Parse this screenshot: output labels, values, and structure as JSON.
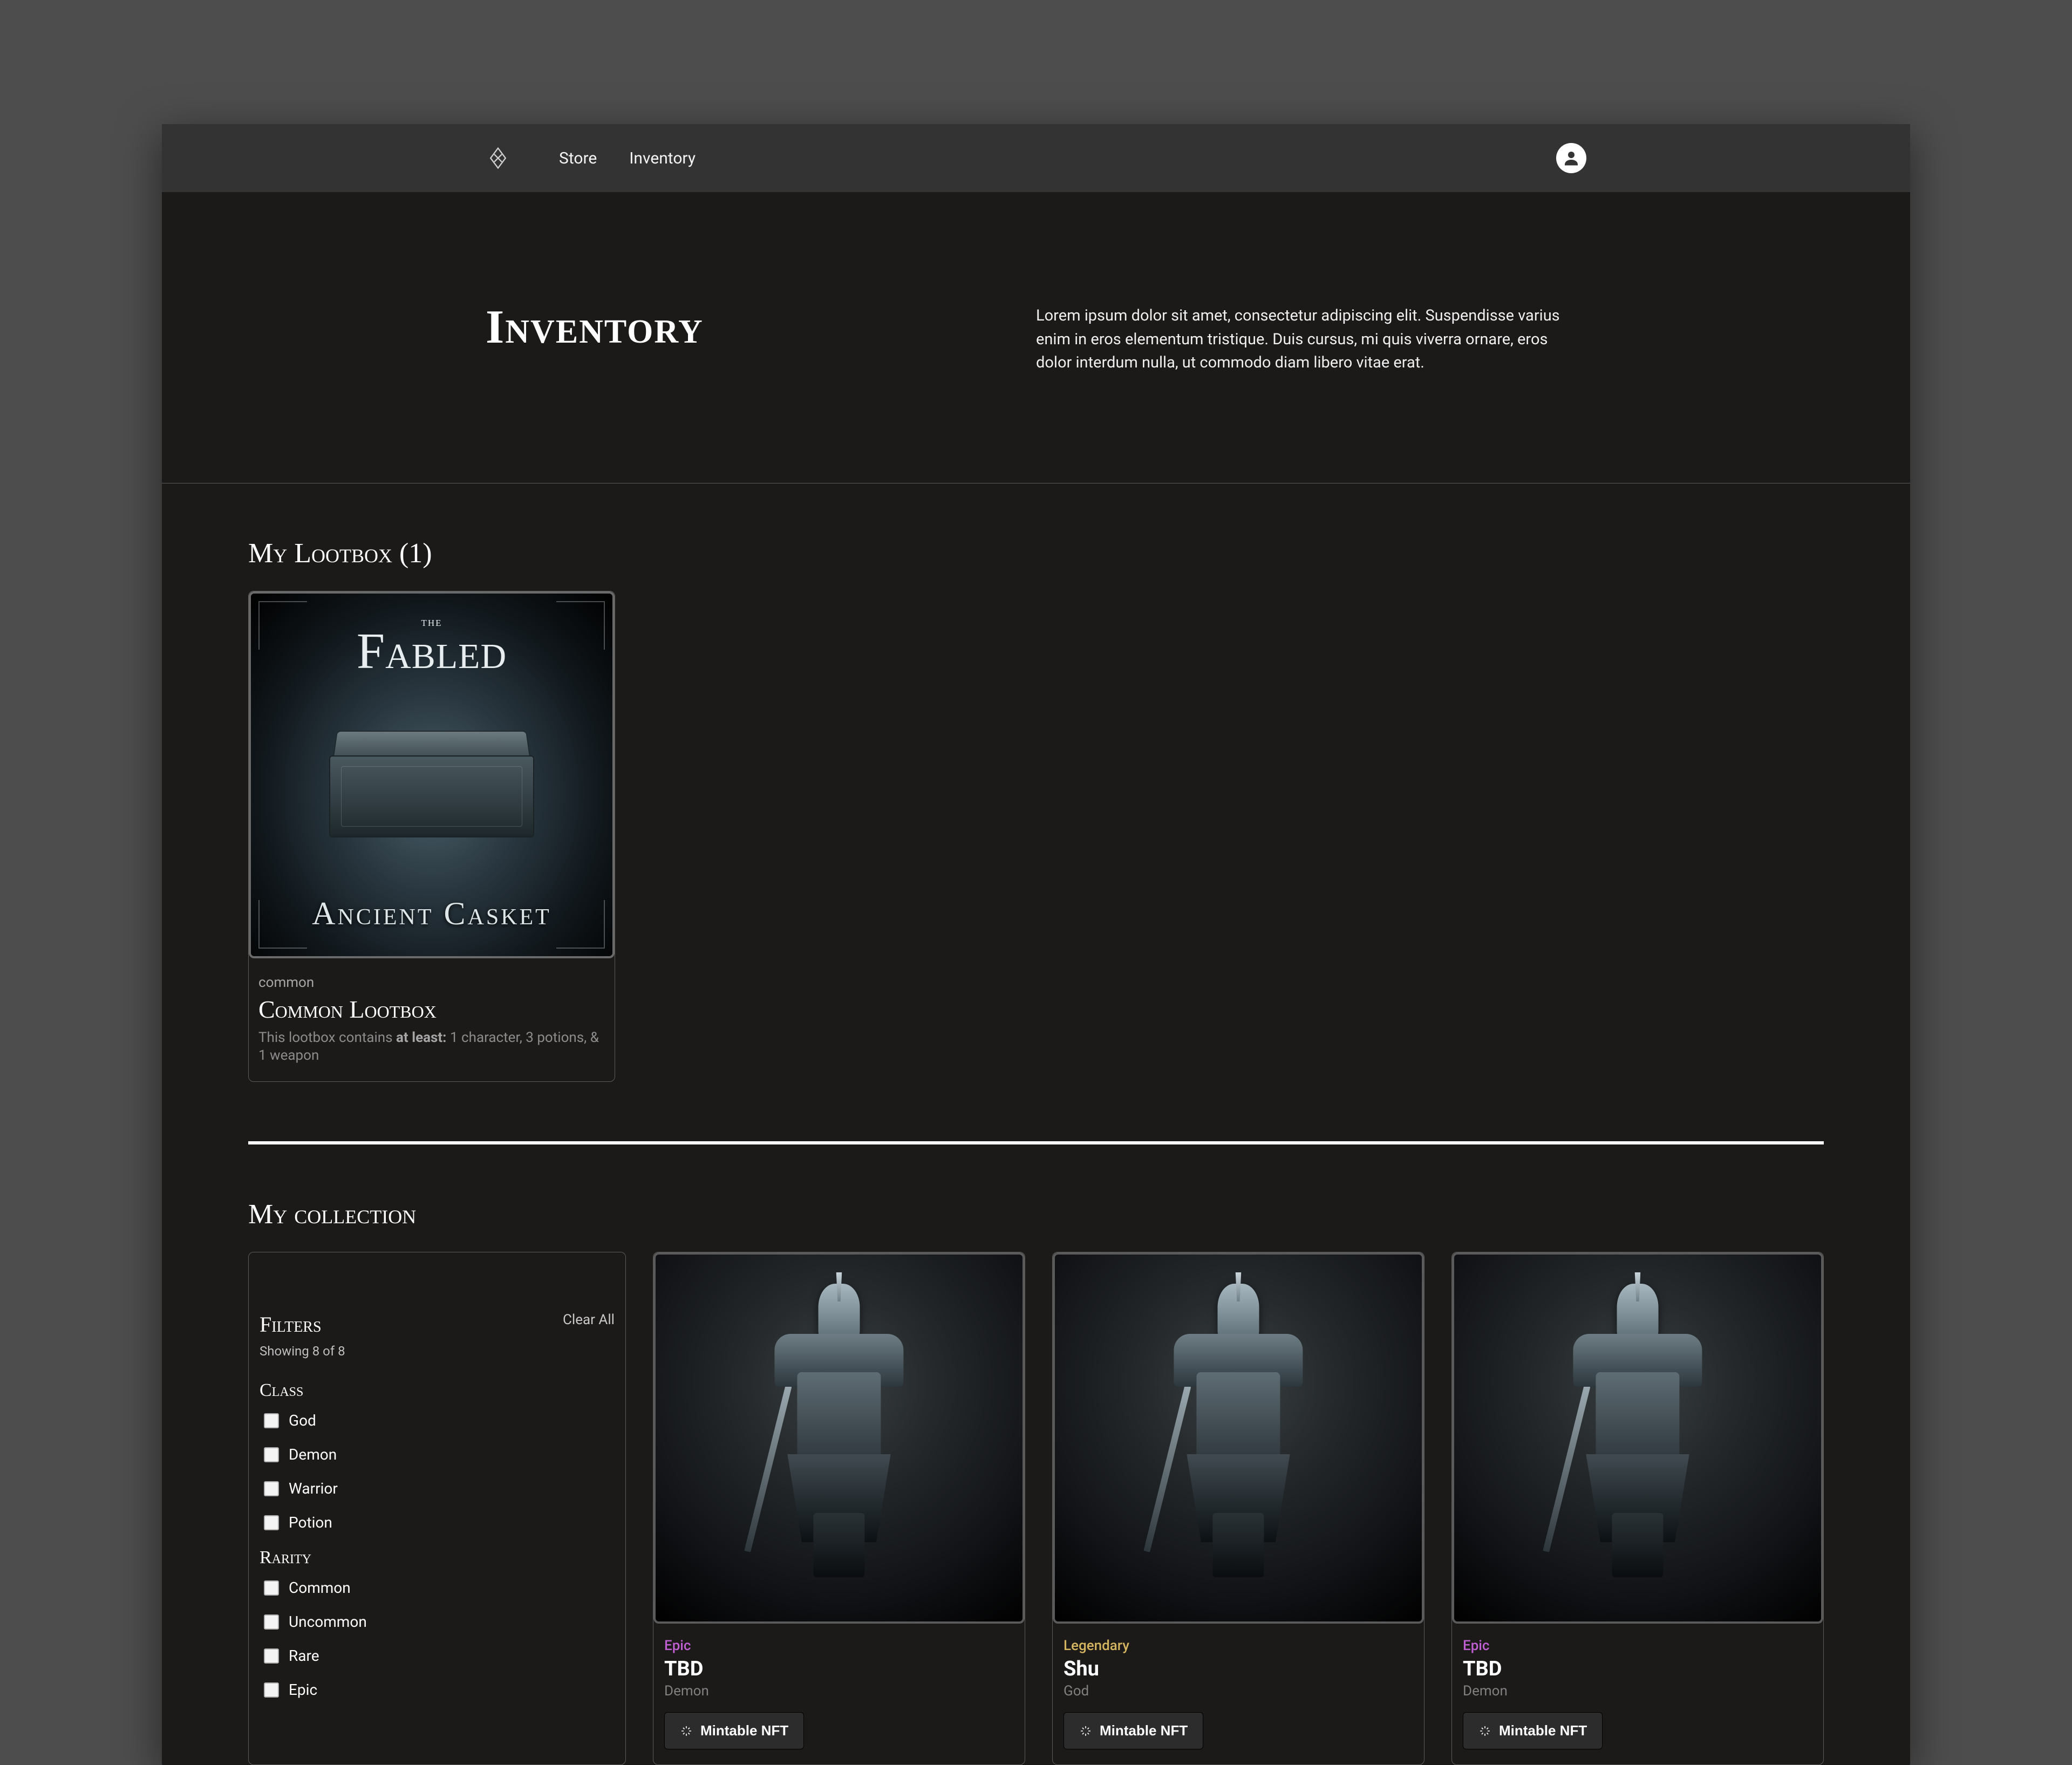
{
  "nav": {
    "store": "Store",
    "inventory": "Inventory"
  },
  "hero": {
    "title": "Inventory",
    "desc": "Lorem ipsum dolor sit amet, consectetur adipiscing elit. Suspendisse varius enim in eros elementum tristique. Duis cursus, mi quis viverra ornare, eros dolor interdum nulla, ut commodo diam libero vitae erat."
  },
  "lootbox": {
    "section_title": "My Lootbox (1)",
    "img_the": "the",
    "img_brand": "Fabled",
    "img_caption": "Ancient Casket",
    "rarity": "common",
    "name": "Common Lootbox",
    "desc_prefix": "This lootbox contains ",
    "desc_strong": "at least:",
    "desc_suffix": " 1 character, 3 potions, & 1 weapon"
  },
  "collection": {
    "section_title": "My collection",
    "filters_title": "Filters",
    "clear_all": "Clear All",
    "showing": "Showing 8 of 8",
    "group_class": "Class",
    "group_rarity": "Rarity",
    "class_options": [
      "God",
      "Demon",
      "Warrior",
      "Potion"
    ],
    "rarity_options": [
      "Common",
      "Uncommon",
      "Rare",
      "Epic"
    ],
    "mint_label": "Mintable NFT",
    "cards": [
      {
        "rarity": "Epic",
        "rarity_cls": "epic",
        "name": "TBD",
        "class": "Demon"
      },
      {
        "rarity": "Legendary",
        "rarity_cls": "legendary",
        "name": "Shu",
        "class": "God"
      },
      {
        "rarity": "Epic",
        "rarity_cls": "epic",
        "name": "TBD",
        "class": "Demon"
      }
    ]
  }
}
